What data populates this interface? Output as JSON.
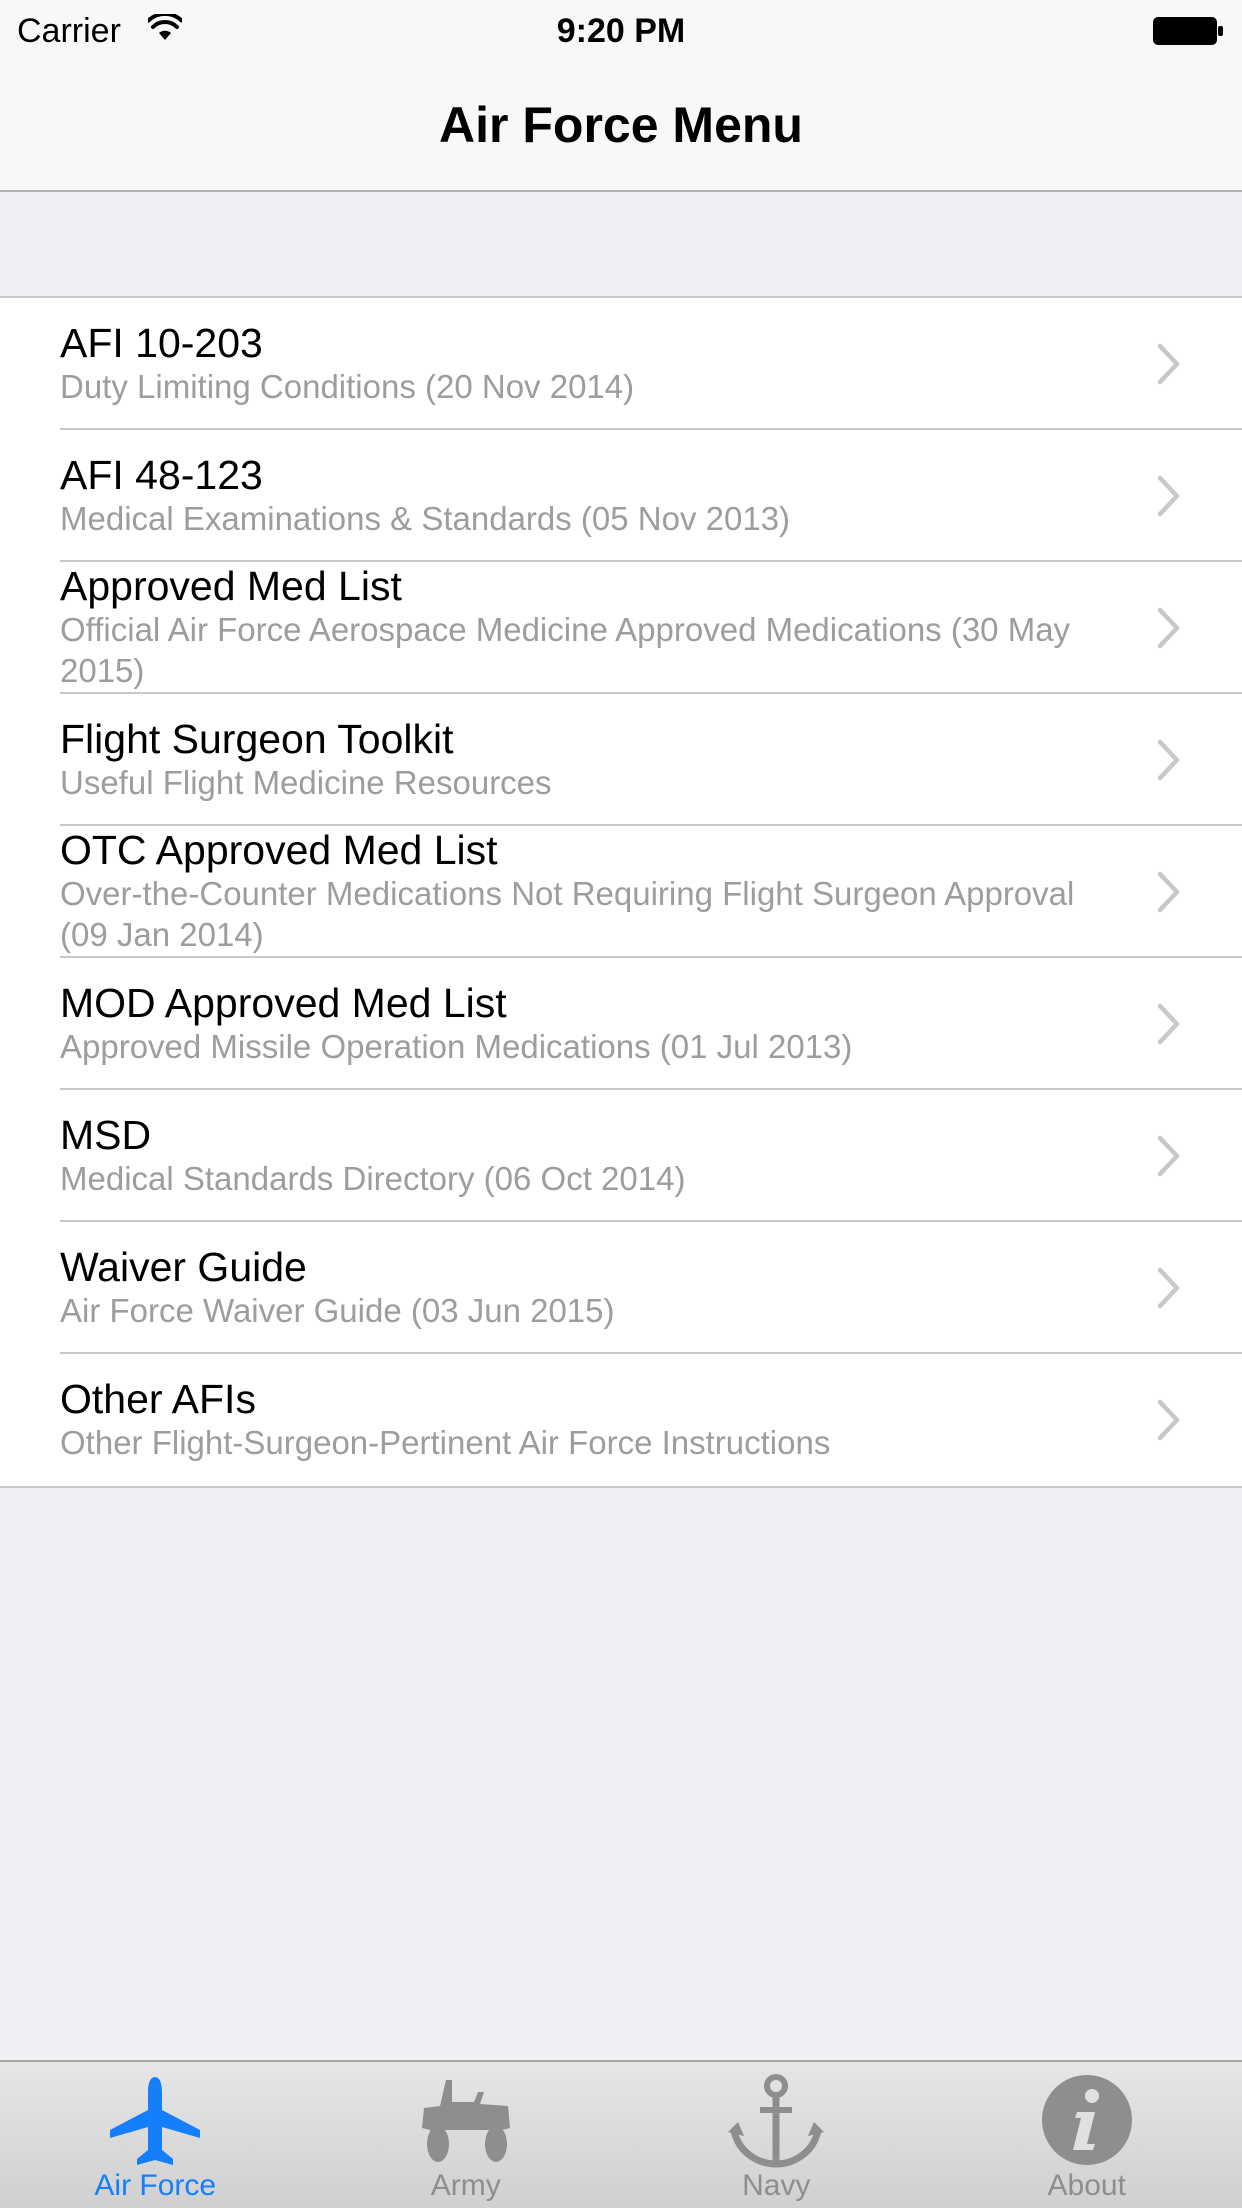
{
  "status_bar": {
    "carrier": "Carrier",
    "time": "9:20 PM",
    "wifi_icon": "wifi-icon",
    "battery_icon": "battery-full-icon"
  },
  "nav_bar": {
    "title": "Air Force Menu"
  },
  "menu": {
    "items": [
      {
        "title": "AFI 10-203",
        "subtitle": "Duty Limiting Conditions (20 Nov 2014)"
      },
      {
        "title": "AFI 48-123",
        "subtitle": "Medical Examinations & Standards (05 Nov 2013)"
      },
      {
        "title": "Approved Med List",
        "subtitle": "Official Air Force Aerospace Medicine Approved Medications (30 May 2015)"
      },
      {
        "title": "Flight Surgeon Toolkit",
        "subtitle": "Useful Flight Medicine Resources"
      },
      {
        "title": "OTC Approved Med List",
        "subtitle": "Over-the-Counter Medications Not Requiring Flight Surgeon Approval (09 Jan 2014)"
      },
      {
        "title": "MOD Approved Med List",
        "subtitle": "Approved Missile Operation Medications (01 Jul 2013)"
      },
      {
        "title": "MSD",
        "subtitle": "Medical Standards Directory (06 Oct 2014)"
      },
      {
        "title": "Waiver Guide",
        "subtitle": "Air Force Waiver Guide (03 Jun 2015)"
      },
      {
        "title": "Other AFIs",
        "subtitle": "Other Flight-Surgeon-Pertinent Air Force Instructions"
      }
    ]
  },
  "tab_bar": {
    "tabs": [
      {
        "label": "Air Force",
        "icon": "airplane-icon",
        "active": true
      },
      {
        "label": "Army",
        "icon": "jeep-icon",
        "active": false
      },
      {
        "label": "Navy",
        "icon": "anchor-icon",
        "active": false
      },
      {
        "label": "About",
        "icon": "info-icon",
        "active": false
      }
    ]
  },
  "colors": {
    "accent": "#147efb",
    "inactive_tab": "#8e8e8e",
    "subtitle": "#9d9d9d",
    "background": "#efeff4"
  }
}
